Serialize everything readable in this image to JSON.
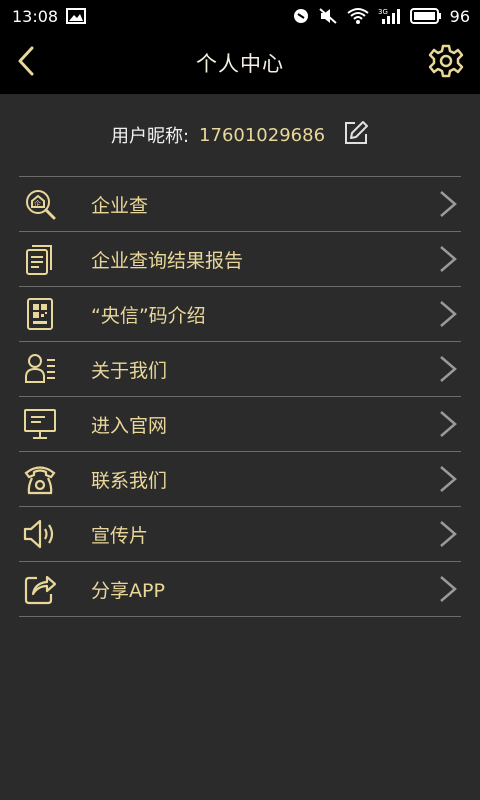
{
  "status_bar": {
    "time": "13:08",
    "battery": "96",
    "icons": [
      "image-icon",
      "do-not-disturb-icon",
      "mute-icon",
      "wifi-icon",
      "signal-icon",
      "battery-icon"
    ]
  },
  "header": {
    "title": "个人中心",
    "back_icon": "back-chevron-icon",
    "settings_icon": "gear-icon"
  },
  "profile": {
    "nickname_label": "用户昵称:",
    "nickname_value": "17601029686",
    "edit_icon": "edit-icon"
  },
  "menu": [
    {
      "label": "企业查",
      "icon": "enterprise-search-icon"
    },
    {
      "label": "企业查询结果报告",
      "icon": "document-report-icon"
    },
    {
      "label": "“央信”码介绍",
      "icon": "qr-code-icon"
    },
    {
      "label": "关于我们",
      "icon": "contact-card-icon"
    },
    {
      "label": "进入官网",
      "icon": "monitor-icon"
    },
    {
      "label": "联系我们",
      "icon": "telephone-icon"
    },
    {
      "label": "宣传片",
      "icon": "speaker-icon"
    },
    {
      "label": "分享APP",
      "icon": "share-icon"
    }
  ],
  "colors": {
    "accent": "#e9d79a",
    "background": "#2b2b2b",
    "bar": "#000000",
    "divider": "#6c6c6c"
  }
}
